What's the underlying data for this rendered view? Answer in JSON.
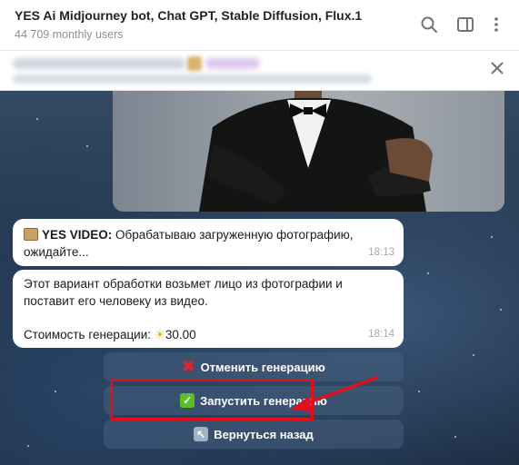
{
  "header": {
    "title": "YES Ai Midjourney bot, Chat GPT, Stable Diffusion, Flux.1",
    "subtitle": "44 709 monthly users",
    "icons": [
      "search-icon",
      "sidebar-panel-icon",
      "more-vertical-icon"
    ]
  },
  "pinned": {
    "close_icon": "close-icon"
  },
  "messages": [
    {
      "sender": "YES VIDEO:",
      "text": " Обрабатываю загруженную фотографию, ожидайте...",
      "time": "18:13"
    },
    {
      "line1": "Этот вариант обработки возьмет лицо из фотографии и",
      "line2": "поставит его человеку из видео.",
      "cost_label": "Стоимость генерации:",
      "cost_value": "30.00",
      "time": "18:14"
    }
  ],
  "keyboard": {
    "cancel_label": "Отменить генерацию",
    "start_label": "Запустить генерацию",
    "back_label": "Вернуться назад"
  },
  "colors": {
    "highlight": "#e3101c",
    "button_bg": "#4a6480",
    "bubble_bg": "#ffffff"
  }
}
